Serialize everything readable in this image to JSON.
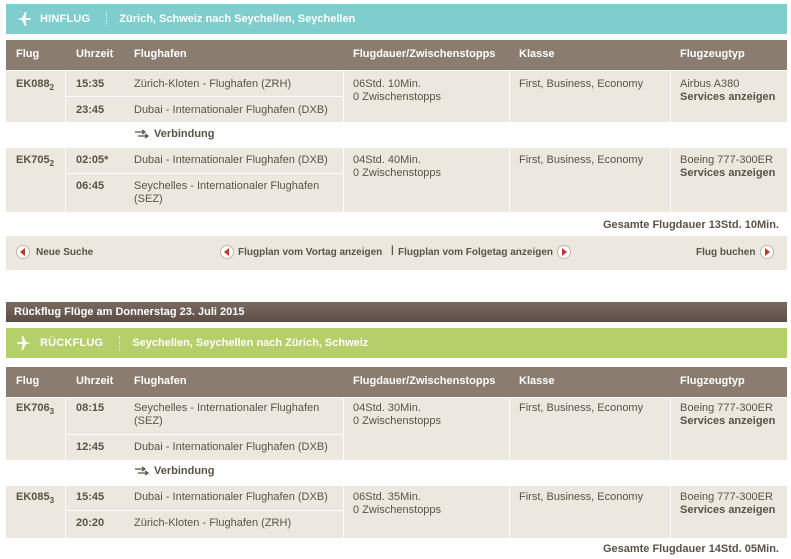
{
  "outbound": {
    "direction": "HINFLUG",
    "route": "Zürich, Schweiz nach Seychellen, Seychellen",
    "total": "Gesamte Flugdauer 13Std. 10Min.",
    "connection": "Verbindung"
  },
  "headers": {
    "flight": "Flug",
    "time": "Uhrzeit",
    "airport": "Flughafen",
    "duration": "Flugdauer/Zwischenstopps",
    "class": "Klasse",
    "aircraft": "Flugzeugtyp"
  },
  "out_flights": [
    {
      "code": "EK088",
      "sub": "2",
      "dep_time": "15:35",
      "dep_airport": "Zürich-Kloten - Flughafen (ZRH)",
      "arr_time": "23:45",
      "arr_airport": "Dubai - Internationaler Flughafen (DXB)",
      "duration": "06Std. 10Min.",
      "stops": "0 Zwischenstopps",
      "class": "First, Business, Economy",
      "aircraft": "Airbus A380",
      "services": "Services anzeigen"
    },
    {
      "code": "EK705",
      "sub": "2",
      "dep_time": "02:05*",
      "dep_airport": "Dubai - Internationaler Flughafen (DXB)",
      "arr_time": "06:45",
      "arr_airport_1": "Seychelles - Internationaler Flughafen",
      "arr_airport_2": "(SEZ)",
      "duration": "04Std. 40Min.",
      "stops": "0 Zwischenstopps",
      "class": "First, Business, Economy",
      "aircraft": "Boeing 777-300ER",
      "services": "Services anzeigen"
    }
  ],
  "nav": {
    "new_search": "Neue Suche",
    "prev_day": "Flugplan vom Vortag anzeigen",
    "divider": "|",
    "next_day": "Flugplan vom Folgetag anzeigen",
    "book": "Flug buchen"
  },
  "return_banner": "Rückflug Flüge am Donnerstag 23. Juli 2015",
  "inbound": {
    "direction": "RÜCKFLUG",
    "route": "Seychellen, Seychellen nach Zürich, Schweiz",
    "total": "Gesamte Flugdauer 14Std. 05Min.",
    "connection": "Verbindung"
  },
  "in_flights": [
    {
      "code": "EK706",
      "sub": "3",
      "dep_time": "08:15",
      "dep_airport_1": "Seychelles - Internationaler Flughafen",
      "dep_airport_2": "(SEZ)",
      "arr_time": "12:45",
      "arr_airport": "Dubai - Internationaler Flughafen (DXB)",
      "duration": "04Std. 30Min.",
      "stops": "0 Zwischenstopps",
      "class": "First, Business, Economy",
      "aircraft": "Boeing 777-300ER",
      "services": "Services anzeigen"
    },
    {
      "code": "EK085",
      "sub": "3",
      "dep_time": "15:45",
      "dep_airport": "Dubai - Internationaler Flughafen (DXB)",
      "arr_time": "20:20",
      "arr_airport": "Zürich-Kloten - Flughafen (ZRH)",
      "duration": "06Std. 35Min.",
      "stops": "0 Zwischenstopps",
      "class": "First, Business, Economy",
      "aircraft": "Boeing 777-300ER",
      "services": "Services anzeigen"
    }
  ],
  "colors": {
    "outbound_band": "#7fcdcd",
    "inbound_band": "#b5cf6a",
    "header_bg": "#8a7d6f",
    "row_bg": "#ede8df"
  }
}
